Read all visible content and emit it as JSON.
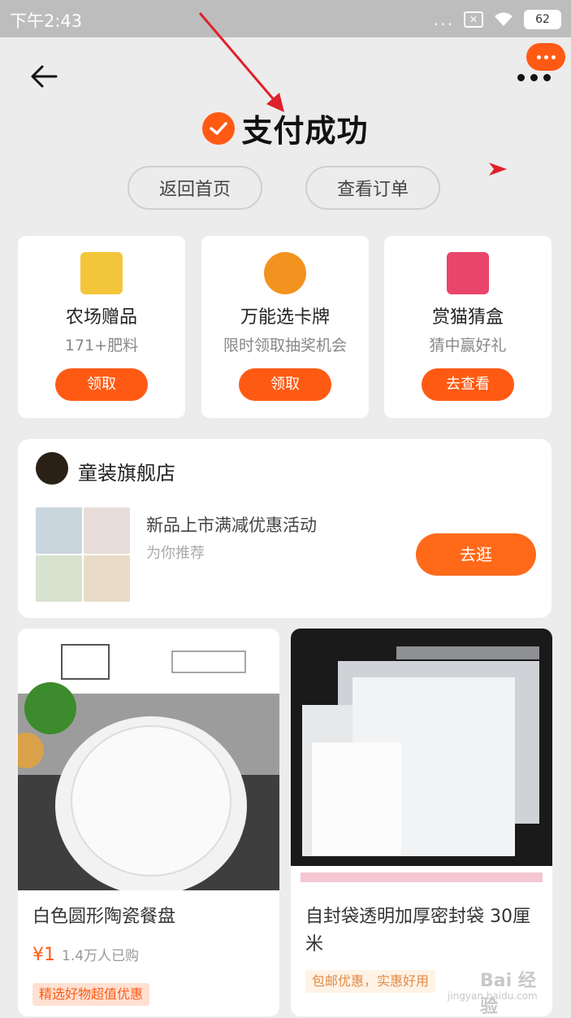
{
  "status_bar": {
    "time": "下午2:43",
    "dots": "...",
    "battery": "62"
  },
  "header": {
    "title": "支付成功",
    "home_button": "返回首页",
    "order_button": "查看订单"
  },
  "services": [
    {
      "name": "农场赠品",
      "sub": "171+肥料",
      "button": "领取",
      "icon_color": "#f3c53a"
    },
    {
      "name": "万能选卡牌",
      "sub": "限时领取抽奖机会",
      "button": "领取",
      "icon_color": "#f3931f"
    },
    {
      "name": "赏猫猜盒",
      "sub": "猜中赢好礼",
      "button": "去查看",
      "icon_color": "#e9456b"
    }
  ],
  "store": {
    "name": "童装旗舰店",
    "promo": "新品上市满减优惠活动",
    "promo_sub": "为你推荐",
    "button": "去逛"
  },
  "products": [
    {
      "title": "白色圆形陶瓷餐盘",
      "price": "¥1",
      "sold": "1.4万人已购",
      "tag": "精选好物超值优惠"
    },
    {
      "title": "自封袋透明加厚密封袋 30厘米",
      "price": "",
      "sold": "",
      "tag": "包邮优惠，实惠好用"
    }
  ],
  "watermark": {
    "brand": "Bai 经验",
    "url": "jingyan.baidu.com"
  },
  "colors": {
    "accent": "#ff5a14",
    "background": "#ececec",
    "status_bar": "#bdbdbd"
  }
}
